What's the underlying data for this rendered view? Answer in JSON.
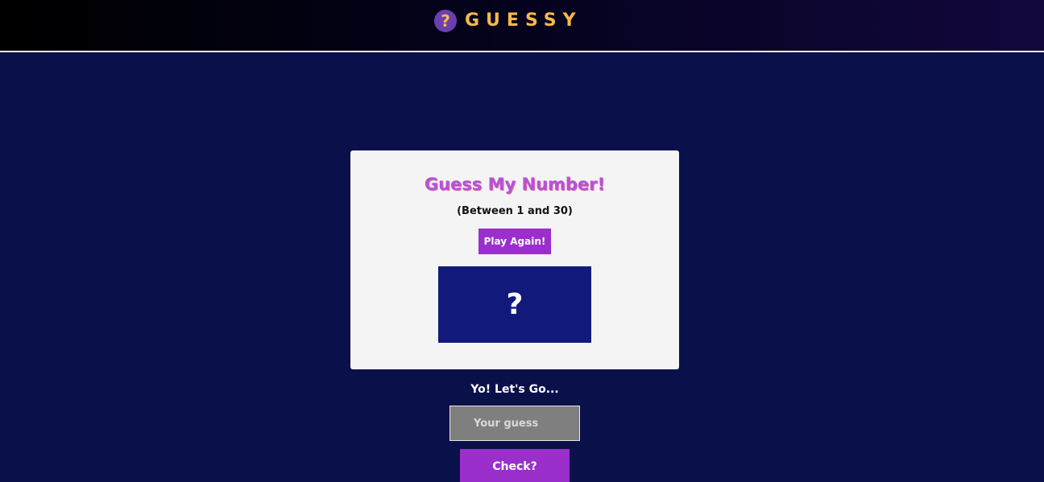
{
  "header": {
    "logo_icon": "?",
    "logo_icon_name": "question-mark-icon",
    "brand_name": "GUESSY"
  },
  "game": {
    "title": "Guess My Number!",
    "range_text": "(Between 1 and 30)",
    "play_again_label": "Play Again!",
    "secret_display": "?"
  },
  "status": {
    "message": "Yo! Let's Go..."
  },
  "guess": {
    "placeholder": "Your guess",
    "value": "",
    "check_label": "Check?"
  },
  "colors": {
    "background": "#0a104a",
    "accent": "#9a2fcc",
    "brand": "#f7b84a",
    "number_box": "#111a7a",
    "card": "#f4f4f5"
  }
}
